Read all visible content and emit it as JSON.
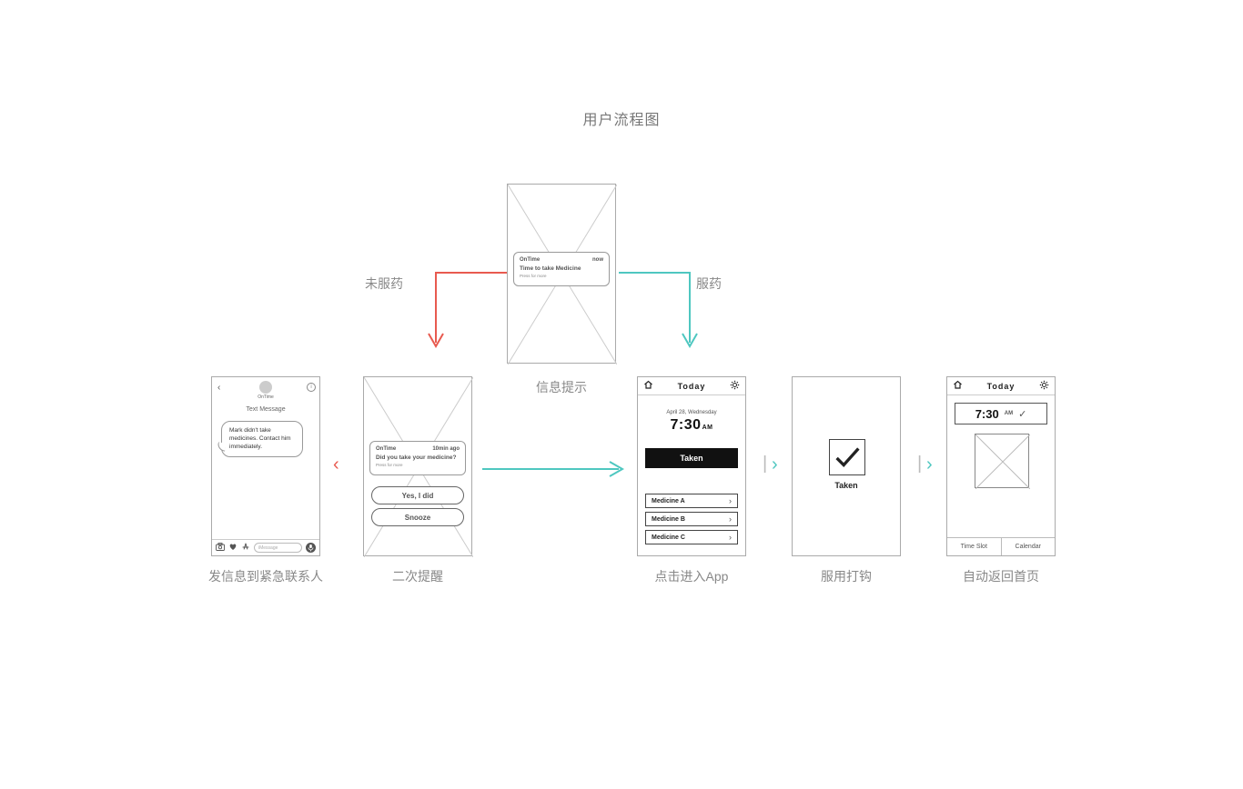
{
  "title": "用户流程图",
  "labels": {
    "notTaken": "未服药",
    "taken": "服药",
    "infoPrompt": "信息提示",
    "sendEmergency": "发信息到紧急联系人",
    "secondReminder": "二次提醒",
    "enterApp": "点击进入App",
    "checkTaken": "服用打钩",
    "returnHome": "自动返回首页"
  },
  "screen1": {
    "appName": "OnTime",
    "subtitle": "Text Message",
    "message": "Mark didn't take medicines. Contact him immediately.",
    "inputPlaceholder": "iMessage"
  },
  "screen2": {
    "app": "OnTime",
    "ago": "10min ago",
    "body": "Did you take your medicine?",
    "press": "Press for more",
    "yes": "Yes, I did",
    "snooze": "Snooze"
  },
  "screen3": {
    "app": "OnTime",
    "now": "now",
    "body": "Time to take Medicine",
    "press": "Press for more"
  },
  "screen4": {
    "today": "Today",
    "date": "April 28, Wednesday",
    "time": "7:30",
    "ampm": "AM",
    "taken": "Taken",
    "medA": "Medicine A",
    "medB": "Medicine B",
    "medC": "Medicine C"
  },
  "screen5": {
    "label": "Taken"
  },
  "screen6": {
    "today": "Today",
    "time": "7:30",
    "ampm": "AM",
    "tab1": "Time Slot",
    "tab2": "Calendar"
  }
}
